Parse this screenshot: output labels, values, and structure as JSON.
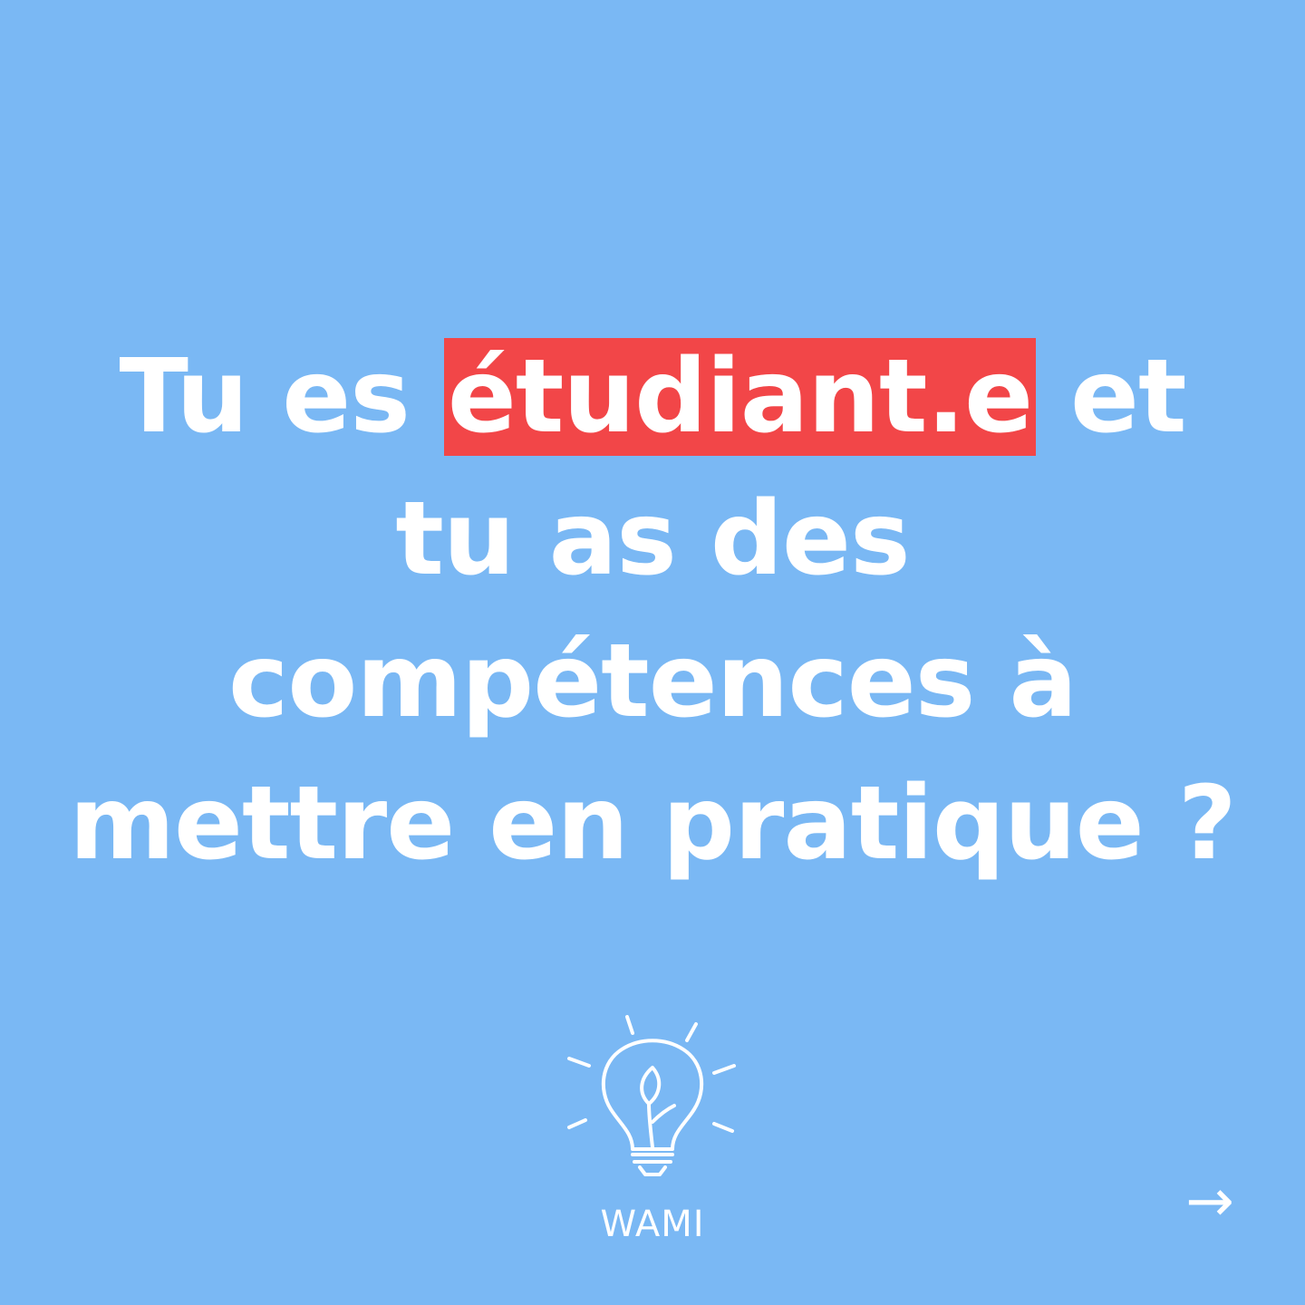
{
  "colors": {
    "background": "#7ab8f4",
    "text": "#ffffff",
    "highlight": "#f24648"
  },
  "headline": {
    "line1_before": "Tu es ",
    "line1_highlight": "étudiant.e",
    "line1_after": " et",
    "line2": "tu as des",
    "line3": "compétences à",
    "line4": "mettre en pratique ?"
  },
  "logo": {
    "icon": "lightbulb-leaf-icon",
    "name": "WAMI"
  },
  "navigation": {
    "next_arrow": "→",
    "next_icon": "arrow-right-icon"
  }
}
